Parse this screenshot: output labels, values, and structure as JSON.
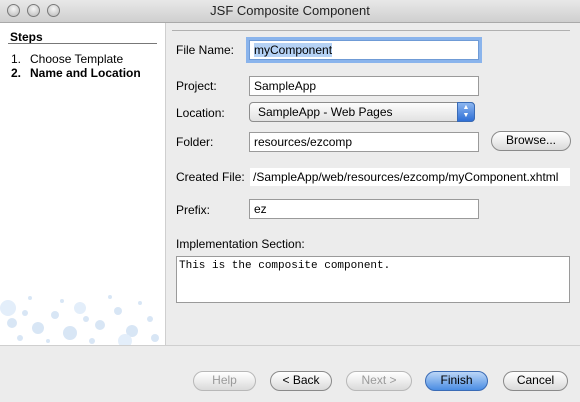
{
  "window": {
    "title": "JSF Composite Component"
  },
  "steps": {
    "header": "Steps",
    "items": [
      {
        "num": "1.",
        "label": "Choose Template"
      },
      {
        "num": "2.",
        "label": "Name and Location"
      }
    ]
  },
  "form": {
    "file_name": {
      "label": "File Name:",
      "value": "myComponent"
    },
    "project": {
      "label": "Project:",
      "value": "SampleApp"
    },
    "location": {
      "label": "Location:",
      "value": "SampleApp - Web Pages"
    },
    "folder": {
      "label": "Folder:",
      "value": "resources/ezcomp",
      "browse_label": "Browse..."
    },
    "created_file": {
      "label": "Created File:",
      "value": "/SampleApp/web/resources/ezcomp/myComponent.xhtml"
    },
    "prefix": {
      "label": "Prefix:",
      "value": "ez"
    },
    "implementation": {
      "label": "Implementation Section:",
      "value": "This is the composite component."
    }
  },
  "buttons": {
    "help": "Help",
    "back": "< Back",
    "next": "Next >",
    "finish": "Finish",
    "cancel": "Cancel"
  },
  "colors": {
    "focus_ring": "#8ab4ec",
    "default_button": "#4a8de3"
  }
}
